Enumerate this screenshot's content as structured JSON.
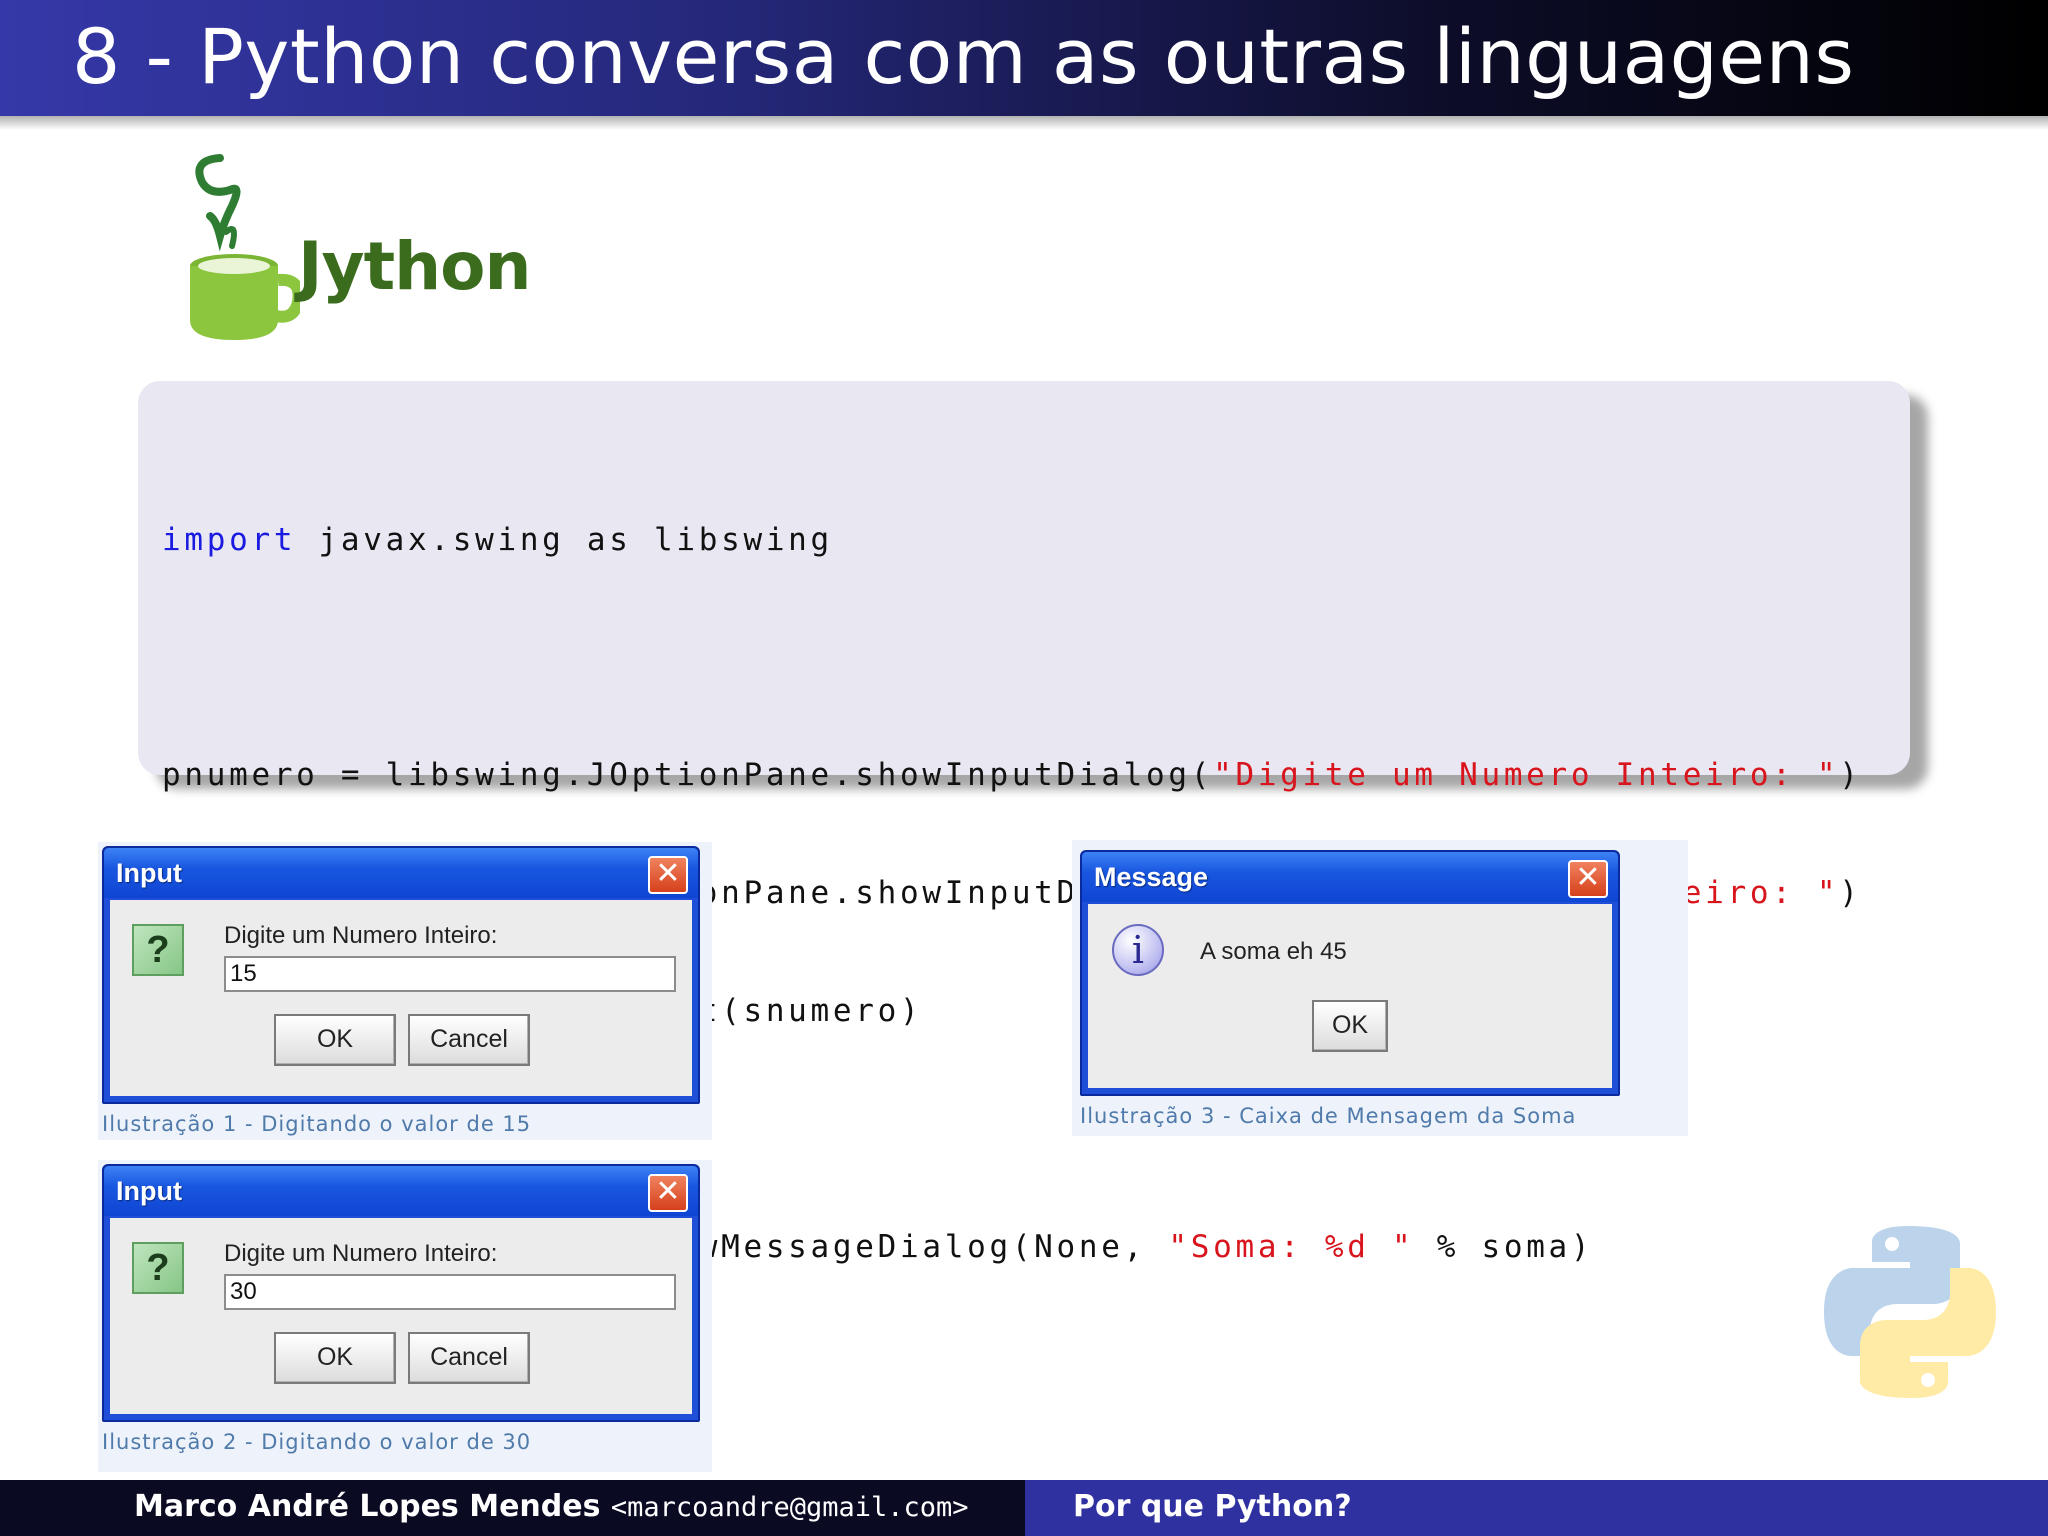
{
  "slide": {
    "title": "8 - Python conversa com as outras linguagens"
  },
  "logo": {
    "text": "Jython",
    "colors": {
      "cup": "#8cc63f",
      "steam": "#2e7d32",
      "text": "#3b6b1c"
    }
  },
  "code": {
    "line1": {
      "kw": "import",
      "rest": " javax.swing as libswing"
    },
    "line2": {
      "pre": "pnumero = libswing.JOptionPane.showInputDialog(",
      "str": "\"Digite um Numero Inteiro: \"",
      "post": ")"
    },
    "line3": {
      "pre": "snumero = libswing.JOptionPane.showInputDialog(",
      "str": "\"Digite um Numero Inteiro: \"",
      "post": ")"
    },
    "line4": {
      "text": "soma = int(pnumero) + int(snumero)"
    },
    "line5": {
      "pre": "libswing.JOptionPane.showMessageDialog(None, ",
      "str": "\"Soma: %d \"",
      "post": " % soma)"
    }
  },
  "dialogs": {
    "input1": {
      "title": "Input",
      "prompt": "Digite um Numero Inteiro:",
      "value": "15",
      "ok_label": "OK",
      "cancel_label": "Cancel",
      "caption": "Ilustração 1 - Digitando o valor de 15"
    },
    "input2": {
      "title": "Input",
      "prompt": "Digite um Numero Inteiro:",
      "value": "30",
      "ok_label": "OK",
      "cancel_label": "Cancel",
      "caption": "Ilustração 2 - Digitando o valor de 30"
    },
    "message": {
      "title": "Message",
      "text": "A soma eh 45",
      "ok_label": "OK",
      "caption": "Ilustração 3 - Caixa de Mensagem da Soma"
    },
    "close_glyph": "✕",
    "question_glyph": "?",
    "info_glyph": "i"
  },
  "footer": {
    "author": "Marco André Lopes Mendes",
    "email": "<marcoandre@gmail.com>",
    "topic": "Por que Python?"
  }
}
